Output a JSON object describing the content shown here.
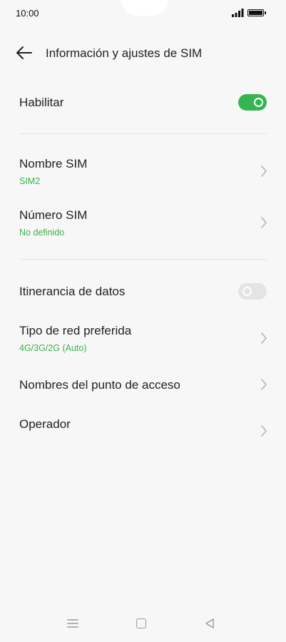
{
  "status_bar": {
    "time": "10:00",
    "signal_icon": "signal-icon",
    "battery_icon": "battery-icon"
  },
  "header": {
    "title": "Información y ajustes de SIM",
    "back_icon": "back-arrow-icon"
  },
  "enable": {
    "label": "Habilitar",
    "enabled": true
  },
  "sim_name": {
    "label": "Nombre SIM",
    "value": "SIM2"
  },
  "sim_number": {
    "label": "Número SIM",
    "value": "No definido"
  },
  "data_roaming": {
    "label": "Itinerancia de datos",
    "enabled": false
  },
  "network_type": {
    "label": "Tipo de red preferida",
    "value": "4G/3G/2G (Auto)"
  },
  "apn": {
    "label": "Nombres del punto de acceso"
  },
  "operator": {
    "label": "Operador"
  },
  "nav_bar": {
    "menu_icon": "menu-icon",
    "home_icon": "home-icon",
    "back_icon": "back-triangle-icon"
  },
  "colors": {
    "accent": "#34b552",
    "subtext": "#3fae4e",
    "background": "#f7f7f7"
  }
}
